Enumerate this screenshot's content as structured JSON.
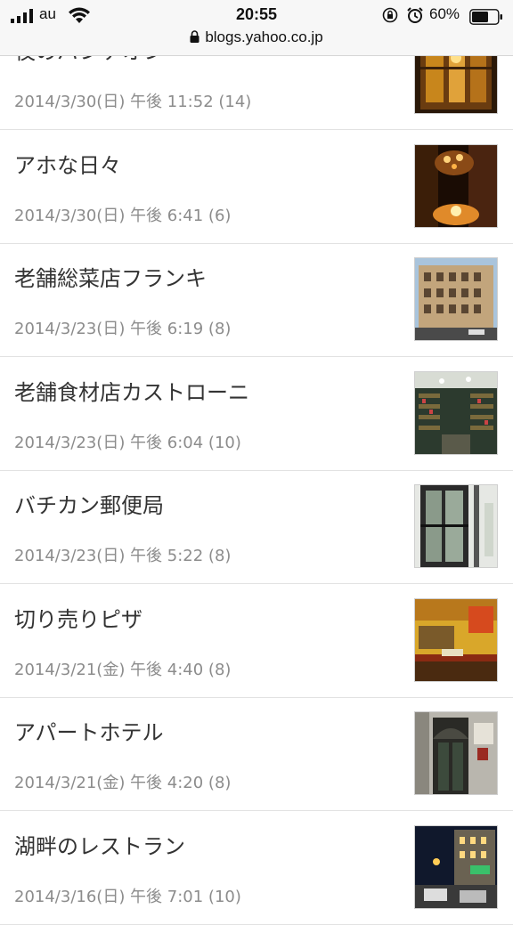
{
  "status_bar": {
    "carrier": "au",
    "time": "20:55",
    "battery_percent": "60%",
    "url": "blogs.yahoo.co.jp"
  },
  "posts": [
    {
      "title": "夜のバンテオン",
      "date": "2014/3/30(日) 午後 11:52 (14)",
      "thumb": "night-lamp-interior"
    },
    {
      "title": "アホな日々",
      "date": "2014/3/30(日) 午後 6:41 (6)",
      "thumb": "candle-chandelier"
    },
    {
      "title": "老舗総菜店フランキ",
      "date": "2014/3/23(日) 午後 6:19 (8)",
      "thumb": "building-facade"
    },
    {
      "title": "老舗食材店カストローニ",
      "date": "2014/3/23(日) 午後 6:04 (10)",
      "thumb": "shop-shelves"
    },
    {
      "title": "バチカン郵便局",
      "date": "2014/3/23(日) 午後 5:22 (8)",
      "thumb": "glass-door"
    },
    {
      "title": "切り売りピザ",
      "date": "2014/3/21(金) 午後 4:40 (8)",
      "thumb": "pizza-counter"
    },
    {
      "title": "アパートホテル",
      "date": "2014/3/21(金) 午後 4:20 (8)",
      "thumb": "hotel-entrance"
    },
    {
      "title": "湖畔のレストラン",
      "date": "2014/3/16(日) 午後 7:01 (10)",
      "thumb": "night-street"
    }
  ],
  "colors": {
    "title_text": "#333333",
    "meta_text": "#8c8c8c",
    "divider": "#e2e2e2",
    "status_bg": "#f7f7f7"
  }
}
